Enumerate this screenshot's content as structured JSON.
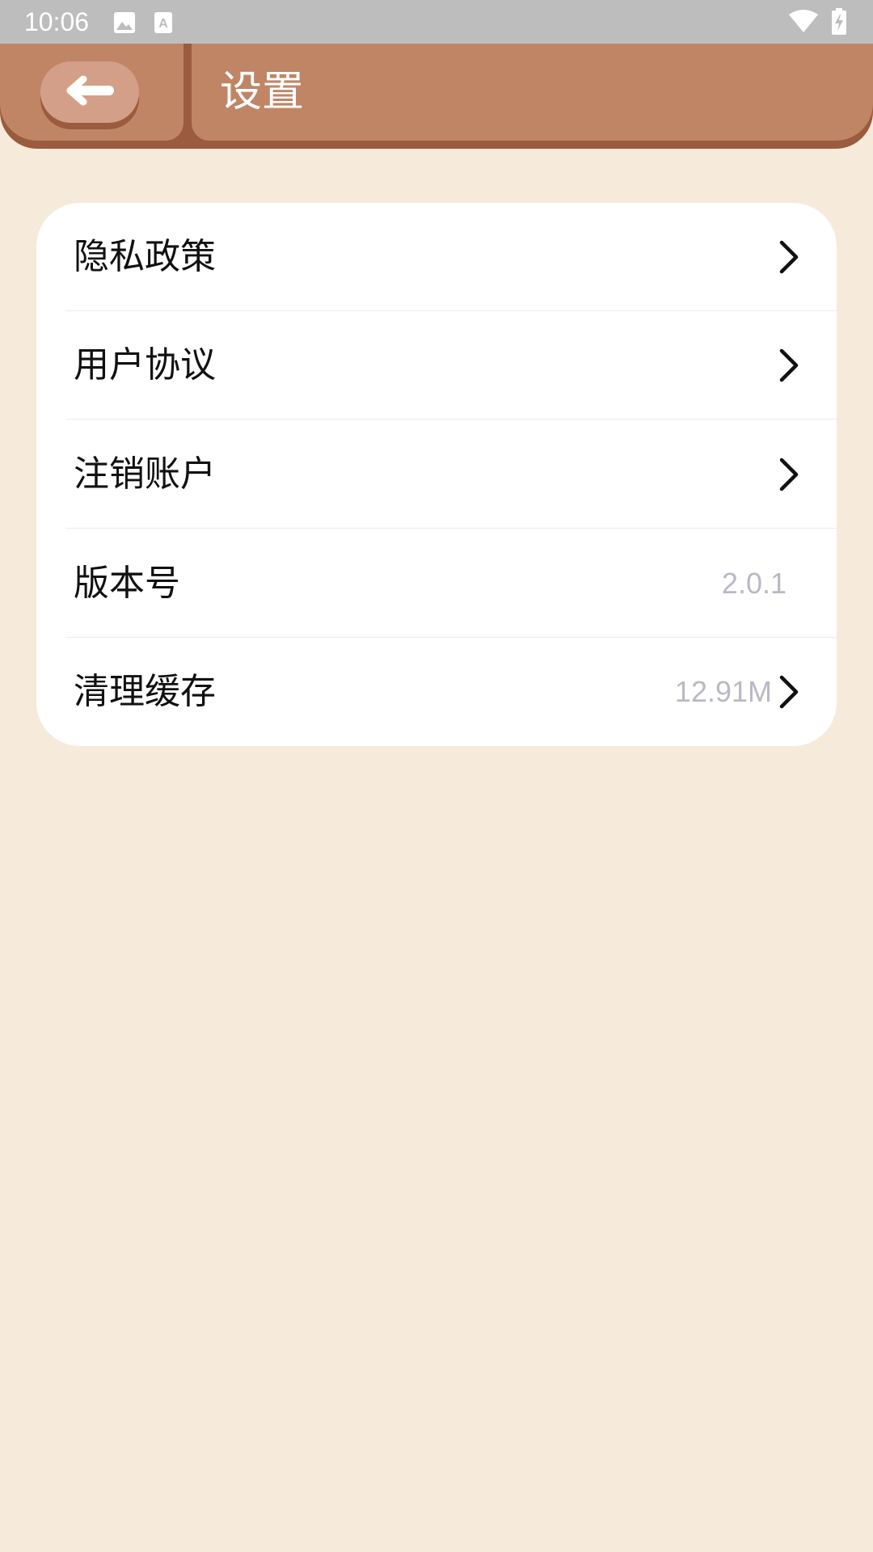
{
  "status_bar": {
    "time": "10:06",
    "icons": [
      "image-icon",
      "text-a-icon",
      "wifi-icon",
      "battery-charging-icon"
    ]
  },
  "header": {
    "title": "设置",
    "back_icon": "arrow-left-icon"
  },
  "colors": {
    "background": "#f6eadb",
    "header": "#c08565",
    "header_shadow": "#9a5b3e",
    "back_button": "#d49f88",
    "card": "#ffffff",
    "value_text": "#b9b9c6"
  },
  "settings": {
    "items": [
      {
        "label": "隐私政策",
        "value": "",
        "chevron": true
      },
      {
        "label": "用户协议",
        "value": "",
        "chevron": true
      },
      {
        "label": "注销账户",
        "value": "",
        "chevron": true
      },
      {
        "label": "版本号",
        "value": "2.0.1",
        "chevron": false
      },
      {
        "label": "清理缓存",
        "value": "12.91M",
        "chevron": true
      }
    ]
  }
}
